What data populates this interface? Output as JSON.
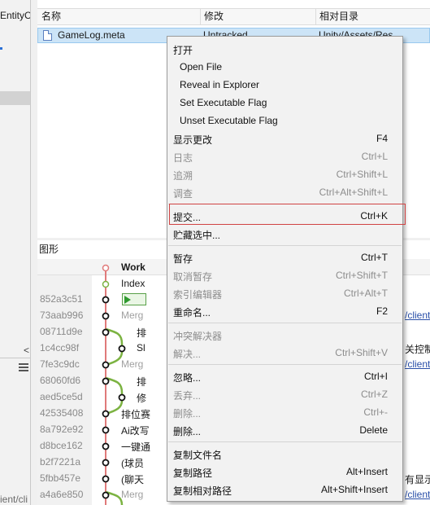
{
  "left_panel": {
    "top_text": "EntityC",
    "bottom_text": "ient/cli"
  },
  "file_list": {
    "columns": [
      "名称",
      "修改",
      "相对目录"
    ],
    "selected_file": {
      "name": "GameLog.meta",
      "status": "Untracked",
      "directory": "Unity/Assets/Res"
    }
  },
  "graph": {
    "title": "图形",
    "rows": [
      {
        "hash": "",
        "subject": "Work",
        "style": "bold"
      },
      {
        "hash": "",
        "subject": "Index",
        "style": "normal"
      },
      {
        "hash": "852a3c51",
        "subject": "",
        "style": "normal"
      },
      {
        "hash": "73aab996",
        "subject": "Merg",
        "style": "merge"
      },
      {
        "hash": "08711d9e",
        "subject": "排",
        "style": "normal"
      },
      {
        "hash": "1c4cc98f",
        "subject": "Sl",
        "style": "normal"
      },
      {
        "hash": "7fe3c9dc",
        "subject": "Merg",
        "style": "merge"
      },
      {
        "hash": "68060fd6",
        "subject": "排",
        "style": "normal"
      },
      {
        "hash": "aed5ce5d",
        "subject": "修",
        "style": "normal"
      },
      {
        "hash": "42535408",
        "subject": "排位赛",
        "style": "normal"
      },
      {
        "hash": "8a792e92",
        "subject": "Ai改写",
        "style": "normal"
      },
      {
        "hash": "d8bce162",
        "subject": "一键通",
        "style": "normal"
      },
      {
        "hash": "b2f7221a",
        "subject": "(球员",
        "style": "normal"
      },
      {
        "hash": "5fbb457e",
        "subject": "(聊天",
        "style": "normal"
      },
      {
        "hash": "a4a6e850",
        "subject": "Merg",
        "style": "merge"
      }
    ],
    "right_texts": {
      "r3": "/client",
      "r5": "关控制",
      "r6": "/client",
      "r13": "有显示",
      "r14": "/client"
    }
  },
  "context_menu": {
    "items": [
      {
        "label": "打开",
        "shortcut": "",
        "indent": false,
        "disabled": false
      },
      {
        "label": "Open File",
        "shortcut": "",
        "indent": true,
        "disabled": false
      },
      {
        "label": "Reveal in Explorer",
        "shortcut": "",
        "indent": true,
        "disabled": false
      },
      {
        "label": "Set Executable Flag",
        "shortcut": "",
        "indent": true,
        "disabled": false
      },
      {
        "label": "Unset Executable Flag",
        "shortcut": "",
        "indent": true,
        "disabled": false
      },
      {
        "label": "显示更改",
        "shortcut": "F4",
        "indent": false,
        "disabled": false
      },
      {
        "label": "日志",
        "shortcut": "Ctrl+L",
        "indent": false,
        "disabled": true
      },
      {
        "label": "追溯",
        "shortcut": "Ctrl+Shift+L",
        "indent": false,
        "disabled": true
      },
      {
        "label": "调查",
        "shortcut": "Ctrl+Alt+Shift+L",
        "indent": false,
        "disabled": true
      },
      {
        "label": "提交...",
        "shortcut": "Ctrl+K",
        "indent": false,
        "disabled": false,
        "highlighted": true
      },
      {
        "label": "贮藏选中...",
        "shortcut": "",
        "indent": false,
        "disabled": false
      },
      {
        "label": "暂存",
        "shortcut": "Ctrl+T",
        "indent": false,
        "disabled": false
      },
      {
        "label": "取消暂存",
        "shortcut": "Ctrl+Shift+T",
        "indent": false,
        "disabled": true
      },
      {
        "label": "索引编辑器",
        "shortcut": "Ctrl+Alt+T",
        "indent": false,
        "disabled": true
      },
      {
        "label": "重命名...",
        "shortcut": "F2",
        "indent": false,
        "disabled": false
      },
      {
        "label": "冲突解决器",
        "shortcut": "",
        "indent": false,
        "disabled": true
      },
      {
        "label": "解决...",
        "shortcut": "Ctrl+Shift+V",
        "indent": false,
        "disabled": true
      },
      {
        "label": "忽略...",
        "shortcut": "Ctrl+I",
        "indent": false,
        "disabled": false
      },
      {
        "label": "丢弃...",
        "shortcut": "Ctrl+Z",
        "indent": false,
        "disabled": true
      },
      {
        "label": "删除...",
        "shortcut": "Ctrl+-",
        "indent": false,
        "disabled": true
      },
      {
        "label": "删除...",
        "shortcut": "Delete",
        "indent": false,
        "disabled": false
      },
      {
        "label": "复制文件名",
        "shortcut": "",
        "indent": false,
        "disabled": false
      },
      {
        "label": "复制路径",
        "shortcut": "Alt+Insert",
        "indent": false,
        "disabled": false
      },
      {
        "label": "复制相对路径",
        "shortcut": "Alt+Shift+Insert",
        "indent": false,
        "disabled": false
      }
    ]
  },
  "colors": {
    "selection": "#cce4f7",
    "menu_background": "#f2f2f2",
    "highlight_border": "#d04343",
    "graph_red": "#e07a7a",
    "graph_green": "#7cb342"
  }
}
